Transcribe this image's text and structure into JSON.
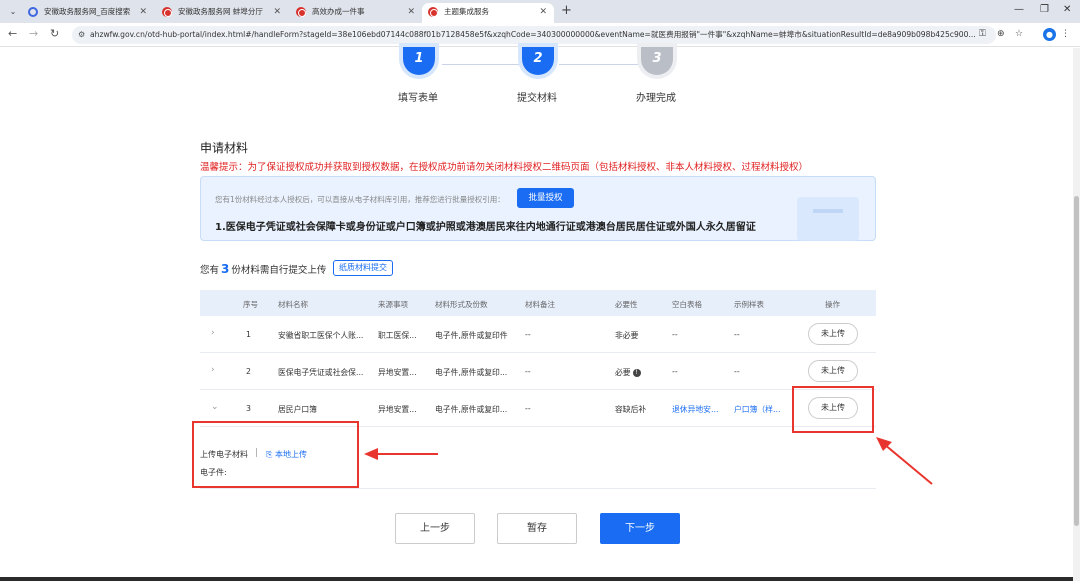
{
  "browser": {
    "tabs": [
      {
        "title": "安徽政务服务网_百度搜索",
        "favicon": "baidu"
      },
      {
        "title": "安徽政务服务网 蚌埠分厅",
        "favicon": "gov"
      },
      {
        "title": "高效办成一件事",
        "favicon": "gov"
      },
      {
        "title": "主题集成服务",
        "favicon": "gov"
      }
    ],
    "new_tab": "+",
    "url": "ahzwfw.gov.cn/otd-hub-portal/index.html#/handleForm?stageId=38e106ebd07144c088f01b7128458e5f&xzqhCode=340300000000&eventName=就医费用报销\"一件事\"&xzqhName=蚌埠市&situationResultId=de8a909b098b425c900..."
  },
  "steps": [
    {
      "number": "1",
      "label": "填写表单",
      "state": "done"
    },
    {
      "number": "2",
      "label": "提交材料",
      "state": "done"
    },
    {
      "number": "3",
      "label": "办理完成",
      "state": "todo"
    }
  ],
  "section": {
    "title": "申请材料",
    "warning": "温馨提示：为了保证授权成功并获取到授权数据，在授权成功前请勿关闭材料授权二维码页面（包括材料授权、非本人材料授权、过程材料授权）"
  },
  "info_box": {
    "hint": "您有1份材料经过本人授权后，可以直接从电子材料库引用，推荐您进行批量授权引用：",
    "batch_button": "批量授权",
    "document": "1.医保电子凭证或社会保障卡或身份证或户口簿或护照或港澳居民来往内地通行证或港澳台居民居住证或外国人永久居留证"
  },
  "count": {
    "prefix": "您有",
    "number": "3",
    "suffix": "份材料需自行提交上传",
    "paper_button": "纸质材料提交"
  },
  "table": {
    "headers": [
      "序号",
      "材料名称",
      "来源事项",
      "材料形式及份数",
      "材料备注",
      "必要性",
      "空白表格",
      "示例样表",
      "操作"
    ],
    "rows": [
      {
        "expand": "›",
        "no": "1",
        "name": "安徽省职工医保个人账...",
        "source": "职工医保...",
        "form": "电子件,原件或复印件",
        "note": "--",
        "necessity": "非必要",
        "blank": "--",
        "sample": "--",
        "action": "未上传"
      },
      {
        "expand": "›",
        "no": "2",
        "name": "医保电子凭证或社会保...",
        "source": "异地安置...",
        "form": "电子件,原件或复印...",
        "note": "--",
        "necessity": "必要",
        "blank": "--",
        "sample": "--",
        "action": "未上传"
      },
      {
        "expand": "⌄",
        "no": "3",
        "name": "居民户口簿",
        "source": "异地安置...",
        "form": "电子件,原件或复印...",
        "note": "--",
        "necessity": "容缺后补",
        "blank": "退休异地安...",
        "sample": "户口簿（样...",
        "action": "未上传"
      }
    ]
  },
  "upload": {
    "label": "上传电子材料",
    "separator": "|",
    "local_upload": "本地上传",
    "file_label": "电子件:"
  },
  "buttons": {
    "prev": "上一步",
    "save": "暂存",
    "next": "下一步"
  },
  "colors": {
    "accent": "#1a6df2",
    "warning": "#e02020",
    "annotation": "#e8362e"
  }
}
